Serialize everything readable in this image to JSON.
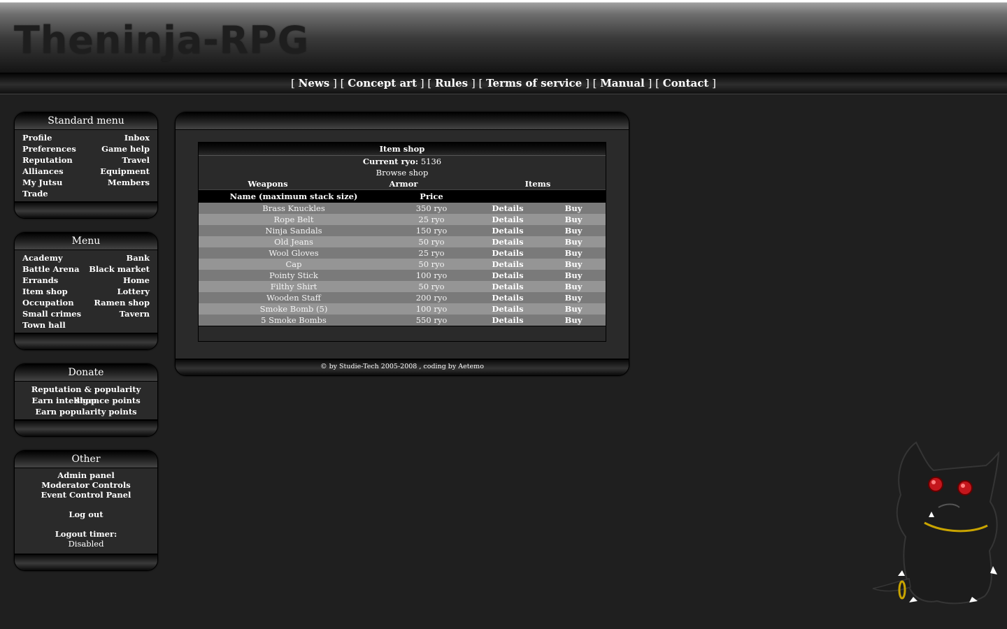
{
  "site": {
    "logo": "Theninja-RPG"
  },
  "nav": {
    "links": [
      "News",
      "Concept art",
      "Rules",
      "Terms of service",
      "Manual",
      "Contact"
    ]
  },
  "standard_menu": {
    "title": "Standard menu",
    "rows": [
      [
        "Profile",
        "Inbox"
      ],
      [
        "Preferences",
        "Game help"
      ],
      [
        "Reputation",
        "Travel"
      ],
      [
        "Alliances",
        "Equipment"
      ],
      [
        "My Jutsu",
        "Members"
      ],
      [
        "Trade",
        ""
      ]
    ]
  },
  "menu": {
    "title": "Menu",
    "rows": [
      [
        "Academy",
        "Bank"
      ],
      [
        "Battle Arena",
        "Black market"
      ],
      [
        "Errands",
        "Home"
      ],
      [
        "Item shop",
        "Lottery"
      ],
      [
        "Occupation",
        "Ramen shop"
      ],
      [
        "Small crimes",
        "Tavern"
      ],
      [
        "Town hall",
        ""
      ]
    ]
  },
  "donate": {
    "title": "Donate",
    "links": [
      "Reputation & popularity shop",
      "Earn intelligence points",
      "Earn popularity points"
    ]
  },
  "other": {
    "title": "Other",
    "links": [
      "Admin panel",
      "Moderator Controls",
      "Event Control Panel"
    ],
    "logout": "Log out",
    "timer_label": "Logout timer:",
    "timer_value": "Disabled"
  },
  "shop": {
    "title": "Item shop",
    "ryo_label": "Current ryo:",
    "ryo_value": "5136",
    "browse": "Browse shop",
    "tabs": [
      "Weapons",
      "Armor",
      "Items"
    ],
    "columns": {
      "name": "Name (maximum stack size)",
      "price": "Price"
    },
    "details_label": "Details",
    "buy_label": "Buy",
    "items": [
      {
        "name": "Brass Knuckles",
        "price": "350 ryo"
      },
      {
        "name": "Rope Belt",
        "price": "25 ryo"
      },
      {
        "name": "Ninja Sandals",
        "price": "150 ryo"
      },
      {
        "name": "Old Jeans",
        "price": "50 ryo"
      },
      {
        "name": "Wool Gloves",
        "price": "25 ryo"
      },
      {
        "name": "Cap",
        "price": "50 ryo"
      },
      {
        "name": "Pointy Stick",
        "price": "100 ryo"
      },
      {
        "name": "Filthy Shirt",
        "price": "50 ryo"
      },
      {
        "name": "Wooden Staff",
        "price": "200 ryo"
      },
      {
        "name": "Smoke Bomb (5)",
        "price": "100 ryo"
      },
      {
        "name": "5 Smoke Bombs",
        "price": "550 ryo"
      }
    ]
  },
  "footer": {
    "text": "© by  Studie-Tech 2005-2008 , coding by  Aetemo"
  },
  "colors": {
    "background": "#1f1f1f",
    "row_dark": "#7a7a7a",
    "row_light": "#959595"
  }
}
